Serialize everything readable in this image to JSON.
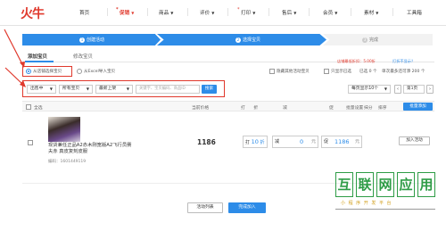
{
  "nav": {
    "logo": "火牛",
    "items": [
      {
        "label": "首页",
        "star": false,
        "caret": false
      },
      {
        "label": "促销",
        "star": true,
        "caret": true,
        "active": true
      },
      {
        "label": "商品",
        "star": false,
        "caret": true
      },
      {
        "label": "评价",
        "star": false,
        "caret": true
      },
      {
        "label": "打印",
        "star": true,
        "caret": true
      },
      {
        "label": "售后",
        "star": false,
        "caret": true
      },
      {
        "label": "会员",
        "star": false,
        "caret": true
      },
      {
        "label": "素材",
        "star": false,
        "caret": true
      },
      {
        "label": "工具箱",
        "star": false,
        "caret": false
      }
    ]
  },
  "steps": [
    {
      "num": "1",
      "label": "创建活动"
    },
    {
      "num": "2",
      "label": "选择宝贝"
    },
    {
      "num": "3",
      "label": "完成"
    }
  ],
  "tabs": {
    "add": "添加宝贝",
    "modify": "修改宝贝"
  },
  "source": {
    "store": "从店铺选择宝贝",
    "excel": "从Excel导入宝贝",
    "hide_joined": "隐藏其他活动宝贝",
    "show_selected": "只显示已选",
    "selected": "已选 0 个",
    "remaining": "单次最多还可添 200 个",
    "discount_note": "店铺最低折扣：5.00折",
    "promo_note": "打折不显示？"
  },
  "filters": {
    "status": "出售中",
    "category": "所有宝贝",
    "sort": "最新上架",
    "search_placeholder": "关键字、宝贝编码、商品ID",
    "search_button": "搜索",
    "page_size": "每页显示10个",
    "page": "第1页"
  },
  "table": {
    "select_all": "全选",
    "headers": {
      "price": "当前价格",
      "discount": "打　　折",
      "reduce": "减",
      "sale": "促",
      "sale_batch": "批量设置",
      "rounding": "抹分",
      "sort": "排序"
    },
    "batch_button": "批量添加"
  },
  "product": {
    "title": "现货兼任正品A2赤木刚宽版A2飞行员赛夫赤 真皮复刻皮服",
    "id": "编码：1601449119",
    "price": "1186",
    "discount_label": "打",
    "discount_value": "10",
    "discount_unit": "折",
    "reduce_label": "减",
    "reduce_value": "0",
    "reduce_unit": "元",
    "sale_label": "促",
    "sale_value": "1186",
    "sale_unit": "元",
    "add_button": "加入活动"
  },
  "footer": {
    "list_button": "活动列表",
    "done_button": "完成加入"
  },
  "watermark": {
    "chars": [
      "互",
      "联",
      "网",
      "应",
      "用"
    ],
    "sub": "小 程 序 开 发 平 台"
  },
  "colors": {
    "accent": "#2d8ce8",
    "brand": "#e0382c",
    "highlight": "#e0382c"
  }
}
